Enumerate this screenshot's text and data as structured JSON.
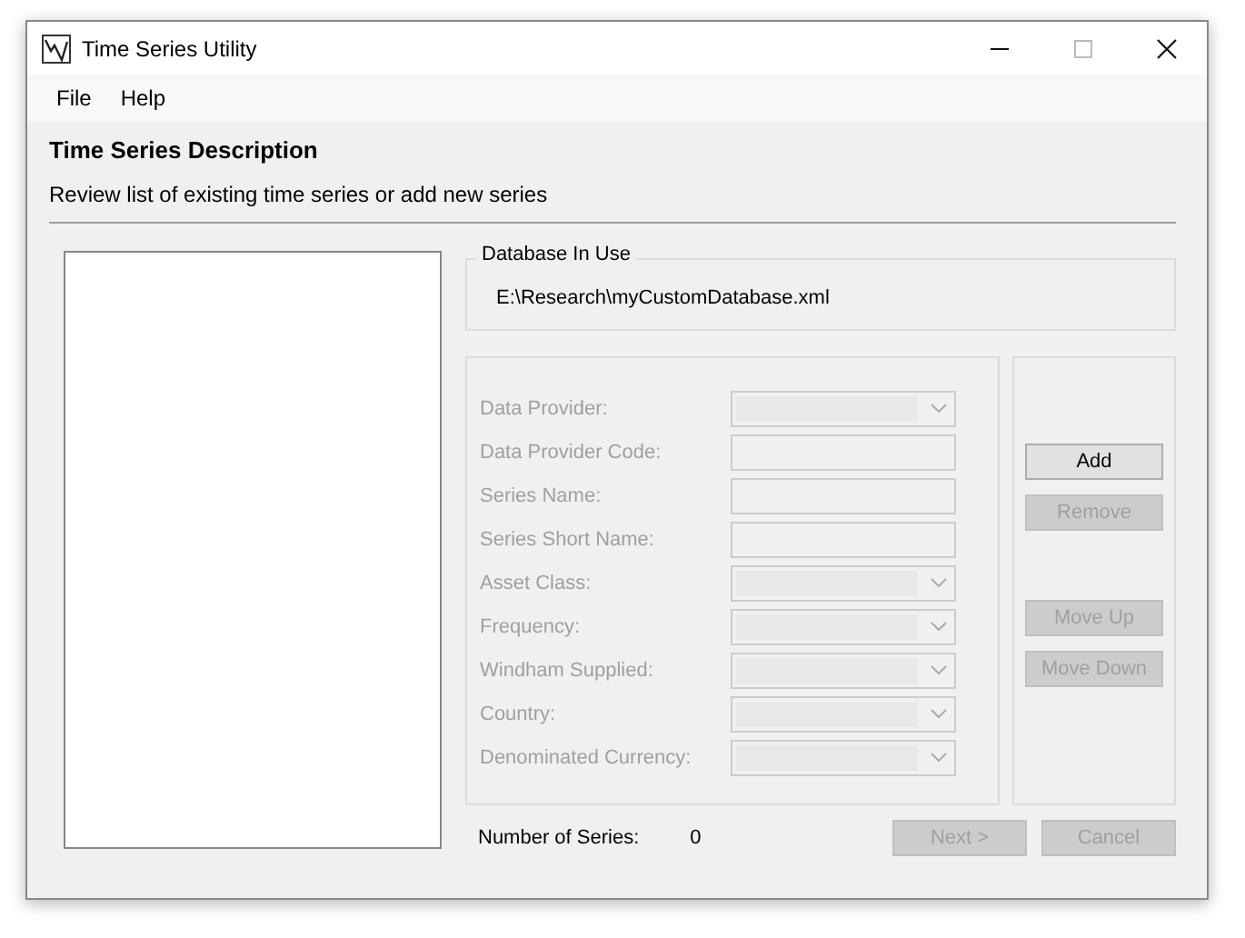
{
  "window": {
    "title": "Time Series Utility"
  },
  "menu": [
    {
      "label": "File"
    },
    {
      "label": "Help"
    }
  ],
  "header": {
    "title": "Time Series Description",
    "subtitle": "Review list of existing time series or add new series"
  },
  "database": {
    "legend": "Database In Use",
    "path": "E:\\Research\\myCustomDatabase.xml"
  },
  "fields": [
    {
      "label": "Data Provider:",
      "kind": "combo",
      "disabled": true
    },
    {
      "label": "Data Provider Code:",
      "kind": "text",
      "disabled": true
    },
    {
      "label": "Series Name:",
      "kind": "text",
      "disabled": true
    },
    {
      "label": "Series Short Name:",
      "kind": "text",
      "disabled": true
    },
    {
      "label": "Asset Class:",
      "kind": "combo",
      "disabled": true
    },
    {
      "label": "Frequency:",
      "kind": "combo",
      "disabled": true
    },
    {
      "label": "Windham Supplied:",
      "kind": "combo",
      "disabled": true
    },
    {
      "label": "Country:",
      "kind": "combo",
      "disabled": true
    },
    {
      "label": "Denominated Currency:",
      "kind": "combo",
      "disabled": true
    }
  ],
  "side_buttons": [
    {
      "label": "Add",
      "disabled": false
    },
    {
      "label": "Remove",
      "disabled": true
    },
    {
      "label": "Move Up",
      "disabled": true
    },
    {
      "label": "Move Down",
      "disabled": true
    }
  ],
  "count": {
    "label": "Number of Series:",
    "value": "0"
  },
  "footer_buttons": [
    {
      "label": "Next >",
      "disabled": true
    },
    {
      "label": "Cancel",
      "disabled": true
    }
  ]
}
